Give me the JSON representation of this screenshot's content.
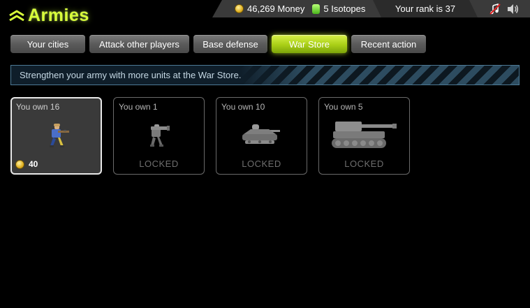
{
  "app": {
    "logo_text": "Armies"
  },
  "status": {
    "money_value": "46,269 Money",
    "isotopes_value": "5 Isotopes",
    "rank_text": "Your rank is 37"
  },
  "nav": {
    "tabs": [
      {
        "label": "Your cities",
        "active": false
      },
      {
        "label": "Attack other players",
        "active": false
      },
      {
        "label": "Base defense",
        "active": false
      },
      {
        "label": "War Store",
        "active": true
      },
      {
        "label": "Recent action",
        "active": false
      }
    ]
  },
  "banner": {
    "text": "Strengthen your army with more units at the War Store."
  },
  "units": [
    {
      "owned": "You own 16",
      "price": "40",
      "state": "available",
      "icon": "rifleman-icon"
    },
    {
      "owned": "You own 1",
      "state_label": "LOCKED",
      "icon": "bazooka-soldier-icon"
    },
    {
      "owned": "You own 10",
      "state_label": "LOCKED",
      "icon": "hover-tank-icon"
    },
    {
      "owned": "You own 5",
      "state_label": "LOCKED",
      "icon": "heavy-tank-icon"
    }
  ],
  "colors": {
    "accent": "#b4d81e",
    "status_bar": "#3a3a3a",
    "banner_border": "#4d7a96"
  }
}
